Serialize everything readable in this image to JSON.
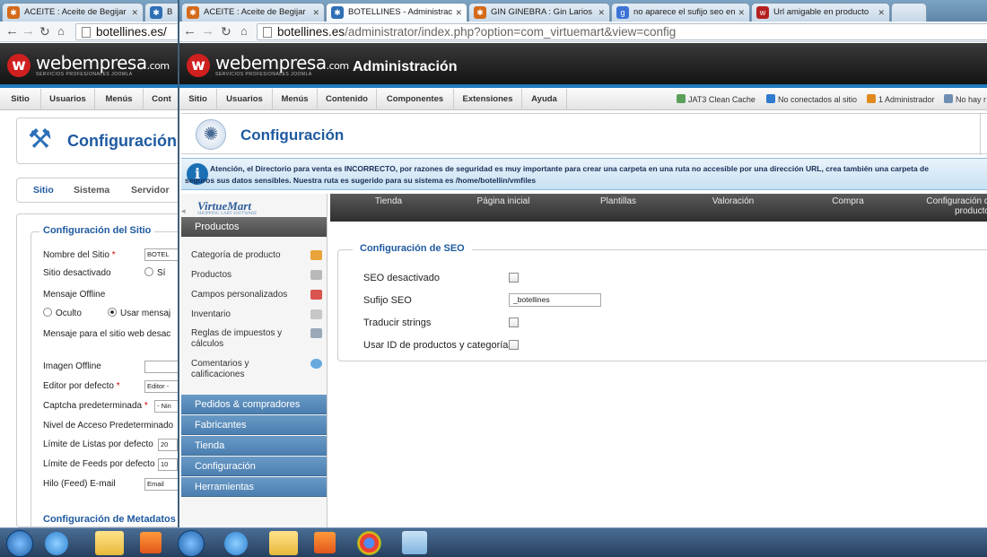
{
  "browser": {
    "tabs": [
      {
        "title": "ACEITE : Aceite de Begijar",
        "color": "#d46a1a"
      },
      {
        "title": "B",
        "color": "#2e6fb5"
      },
      {
        "title": "ACEITE : Aceite de Begijar",
        "color": "#d46a1a"
      },
      {
        "title": "BOTELLINES - Administrac",
        "color": "#2e6fb5",
        "active": true
      },
      {
        "title": "GIN GINEBRA : Gin Larios",
        "color": "#d46a1a"
      },
      {
        "title": "no aparece el sufijo seo en",
        "color": "#3b73d6"
      },
      {
        "title": "Url amigable en producto",
        "color": "#b51f1f"
      }
    ],
    "url_left": {
      "host": "botellines.es/",
      "path": ""
    },
    "url_right": {
      "host": "botellines.es",
      "path": "/administrator/index.php?option=com_virtuemart&view=config"
    }
  },
  "header": {
    "logo_text": "webempresa",
    "logo_suffix": ".com",
    "logo_tagline": "SERVICIOS PROFESIONALES JOOMLA",
    "admin_title": "Administración"
  },
  "menu": {
    "items": [
      "Sitio",
      "Usuarios",
      "Menús",
      "Contenido",
      "Componentes",
      "Extensiones",
      "Ayuda"
    ],
    "left_items": [
      "Sitio",
      "Usuarios",
      "Menús",
      "Cont"
    ],
    "status": {
      "cache": "JAT3 Clean Cache",
      "visitors": "No conectados al sitio",
      "admins": "1 Administrador",
      "messages": "No hay r"
    }
  },
  "left_page": {
    "title": "Configuración",
    "tabs": [
      "Sitio",
      "Sistema",
      "Servidor"
    ],
    "fieldset_title": "Configuración del Sitio",
    "rows": [
      {
        "label": "Nombre del Sitio",
        "required": true,
        "value": "BOTEL"
      },
      {
        "label": "Sitio desactivado",
        "value": "Sí"
      },
      {
        "label": "Mensaje Offline"
      },
      {
        "label": "Oculto",
        "value": "Usar mensaj"
      },
      {
        "label": "Mensaje para el sitio web desac"
      },
      {
        "label": "Imagen Offline",
        "value": ""
      },
      {
        "label": "Editor por defecto",
        "required": true,
        "value": "Editor -"
      },
      {
        "label": "Captcha predeterminada",
        "required": true,
        "value": "- Nin"
      },
      {
        "label": "Nivel de Acceso Predeterminado"
      },
      {
        "label": "Límite de Listas por defecto",
        "value": "20"
      },
      {
        "label": "Límite de Feeds por defecto",
        "value": "10"
      },
      {
        "label": "Hilo (Feed) E-mail",
        "value": "Email"
      }
    ],
    "metadata_title": "Configuración de Metadatos"
  },
  "right_page": {
    "title": "Configuración",
    "notice_line1": "Atención, el Directorio para venta es INCORRECTO, por razones de seguridad es muy importante para crear una carpeta en una ruta no accesible por una dirección URL, crea también una carpeta de",
    "notice_line2": "seguros sus datos sensibles. Nuestra ruta es sugerido para su sistema es /home/botellin/vmfiles",
    "vm_logo": "VirtueMart",
    "vm_logo_sub": "SHOPPING CART SOFTWARE",
    "vm_menu": {
      "productos_header": "Productos",
      "productos_items": [
        {
          "label": "Categoría de producto",
          "icon_color": "#e8a33a"
        },
        {
          "label": "Productos",
          "icon_color": "#b9b9b9"
        },
        {
          "label": "Campos personalizados",
          "icon_color": "#d9534f"
        },
        {
          "label": "Inventario",
          "icon_color": "#c7c7c7"
        },
        {
          "label": "Reglas de impuestos y cálculos",
          "icon_color": "#9aa9b8"
        },
        {
          "label": "Comentarios y calificaciones",
          "icon_color": "#67a9de"
        }
      ],
      "sections": [
        "Pedidos & compradores",
        "Fabricantes",
        "Tienda",
        "Configuración",
        "Herramientas"
      ]
    },
    "config_tabs": [
      "Tienda",
      "Página inicial",
      "Plantillas",
      "Valoración",
      "Compra",
      "Configuración de productos"
    ],
    "seo": {
      "legend": "Configuración de SEO",
      "disabled_label": "SEO desactivado",
      "suffix_label": "Sufijo SEO",
      "suffix_value": "_botellines",
      "translate_label": "Traducir strings",
      "use_id_label": "Usar ID de productos y categorías"
    }
  },
  "taskbar": {
    "items": [
      "start",
      "ie",
      "explorer",
      "media",
      "start2",
      "ie2",
      "explorer2",
      "media2",
      "chrome",
      "paint"
    ]
  }
}
